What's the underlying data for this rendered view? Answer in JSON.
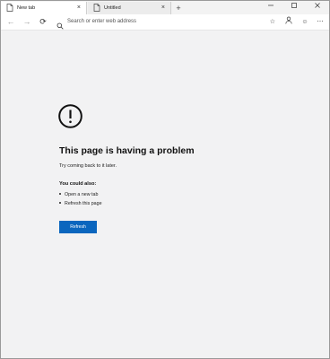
{
  "tabs": [
    {
      "title": "New tab",
      "active": true
    },
    {
      "title": "Untitled",
      "active": false
    }
  ],
  "tab_close_glyph": "×",
  "new_tab_glyph": "+",
  "window_controls": {
    "minimize": "—",
    "maximize": "☐",
    "close": "✕"
  },
  "toolbar": {
    "back_icon": "←",
    "forward_icon": "→",
    "refresh_icon": "⟳",
    "address_placeholder": "Search or enter web address",
    "favorite_icon": "☆",
    "profile_icon": "person-icon",
    "feedback_icon": "☺",
    "menu_icon": "⋯"
  },
  "error": {
    "icon": "!",
    "title": "This page is having a problem",
    "subtitle": "Try coming back to it later.",
    "could_label": "You could also:",
    "options": [
      "Open a new tab",
      "Refresh this page"
    ],
    "button_label": "Refresh"
  },
  "colors": {
    "accent": "#0b66be",
    "background": "#f2f2f3"
  }
}
